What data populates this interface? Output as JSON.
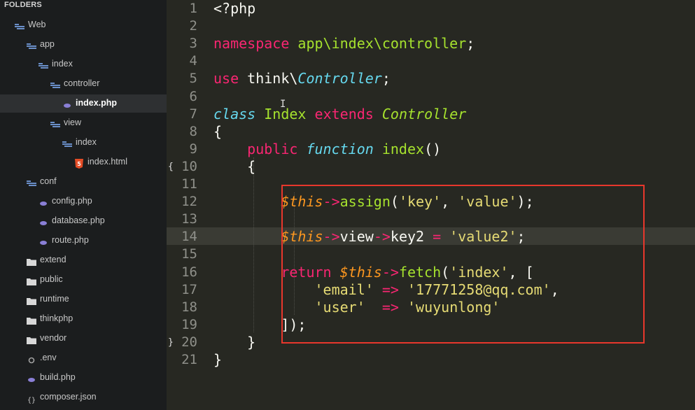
{
  "sidebar": {
    "title": "FOLDERS",
    "items": [
      {
        "label": "Web",
        "kind": "folder-open",
        "depth": 1
      },
      {
        "label": "app",
        "kind": "folder-open",
        "depth": 2
      },
      {
        "label": "index",
        "kind": "folder-open",
        "depth": 3
      },
      {
        "label": "controller",
        "kind": "folder-open",
        "depth": 4
      },
      {
        "label": "index.php",
        "kind": "file-php",
        "depth": 5,
        "selected": true
      },
      {
        "label": "view",
        "kind": "folder-open",
        "depth": 4
      },
      {
        "label": "index",
        "kind": "folder-open",
        "depth": 5
      },
      {
        "label": "index.html",
        "kind": "file-html",
        "depth": 6
      },
      {
        "label": "conf",
        "kind": "folder-open",
        "depth": 2
      },
      {
        "label": "config.php",
        "kind": "file-php",
        "depth": 3
      },
      {
        "label": "database.php",
        "kind": "file-php",
        "depth": 3
      },
      {
        "label": "route.php",
        "kind": "file-php",
        "depth": 3
      },
      {
        "label": "extend",
        "kind": "folder",
        "depth": 2
      },
      {
        "label": "public",
        "kind": "folder",
        "depth": 2
      },
      {
        "label": "runtime",
        "kind": "folder",
        "depth": 2
      },
      {
        "label": "thinkphp",
        "kind": "folder",
        "depth": 2
      },
      {
        "label": "vendor",
        "kind": "folder",
        "depth": 2
      },
      {
        "label": ".env",
        "kind": "file-env",
        "depth": 2
      },
      {
        "label": "build.php",
        "kind": "file-php",
        "depth": 2
      },
      {
        "label": "composer.json",
        "kind": "file-json",
        "depth": 2
      }
    ]
  },
  "editor": {
    "line_numbers": [
      "1",
      "2",
      "3",
      "4",
      "5",
      "6",
      "7",
      "8",
      "9",
      "10",
      "11",
      "12",
      "13",
      "14",
      "15",
      "16",
      "17",
      "18",
      "19",
      "20",
      "21"
    ],
    "fold_markers": [
      {
        "line": 10,
        "glyph": "{"
      },
      {
        "line": 20,
        "glyph": "}"
      }
    ],
    "highlighted_line": 14,
    "lines": [
      [
        {
          "t": "<?php",
          "c": ""
        }
      ],
      [],
      [
        {
          "t": "namespace",
          "c": "kw"
        },
        {
          "t": " app\\index\\controller",
          "c": "ns"
        },
        {
          "t": ";",
          "c": ""
        }
      ],
      [],
      [
        {
          "t": "use",
          "c": "kw"
        },
        {
          "t": " think\\",
          "c": ""
        },
        {
          "t": "Controller",
          "c": "cls"
        },
        {
          "t": ";",
          "c": ""
        }
      ],
      [],
      [
        {
          "t": "class",
          "c": "cls"
        },
        {
          "t": " ",
          "c": ""
        },
        {
          "t": "Index",
          "c": "ns"
        },
        {
          "t": " ",
          "c": ""
        },
        {
          "t": "extends",
          "c": "kw"
        },
        {
          "t": " ",
          "c": ""
        },
        {
          "t": "Controller",
          "c": "parent"
        }
      ],
      [
        {
          "t": "{",
          "c": ""
        }
      ],
      [
        {
          "t": "    ",
          "c": ""
        },
        {
          "t": "public",
          "c": "kw"
        },
        {
          "t": " ",
          "c": ""
        },
        {
          "t": "function",
          "c": "fnkw"
        },
        {
          "t": " ",
          "c": ""
        },
        {
          "t": "index",
          "c": "fn"
        },
        {
          "t": "()",
          "c": ""
        }
      ],
      [
        {
          "t": "    {",
          "c": ""
        }
      ],
      [],
      [
        {
          "t": "        ",
          "c": ""
        },
        {
          "t": "$this",
          "c": "var"
        },
        {
          "t": "->",
          "c": "kw"
        },
        {
          "t": "assign",
          "c": "fn"
        },
        {
          "t": "(",
          "c": ""
        },
        {
          "t": "'key'",
          "c": "str"
        },
        {
          "t": ", ",
          "c": ""
        },
        {
          "t": "'value'",
          "c": "str"
        },
        {
          "t": ");",
          "c": ""
        }
      ],
      [],
      [
        {
          "t": "        ",
          "c": ""
        },
        {
          "t": "$this",
          "c": "var"
        },
        {
          "t": "->",
          "c": "kw"
        },
        {
          "t": "view",
          "c": ""
        },
        {
          "t": "->",
          "c": "kw"
        },
        {
          "t": "key2 ",
          "c": ""
        },
        {
          "t": "=",
          "c": "kw"
        },
        {
          "t": " ",
          "c": ""
        },
        {
          "t": "'value2'",
          "c": "str"
        },
        {
          "t": ";",
          "c": ""
        }
      ],
      [],
      [
        {
          "t": "        ",
          "c": ""
        },
        {
          "t": "return",
          "c": "kw"
        },
        {
          "t": " ",
          "c": ""
        },
        {
          "t": "$this",
          "c": "var"
        },
        {
          "t": "->",
          "c": "kw"
        },
        {
          "t": "fetch",
          "c": "fn"
        },
        {
          "t": "(",
          "c": ""
        },
        {
          "t": "'index'",
          "c": "str"
        },
        {
          "t": ", [",
          "c": ""
        }
      ],
      [
        {
          "t": "            ",
          "c": ""
        },
        {
          "t": "'email'",
          "c": "str"
        },
        {
          "t": " ",
          "c": ""
        },
        {
          "t": "=>",
          "c": "kw"
        },
        {
          "t": " ",
          "c": ""
        },
        {
          "t": "'17771258@qq.com'",
          "c": "str"
        },
        {
          "t": ",",
          "c": ""
        }
      ],
      [
        {
          "t": "            ",
          "c": ""
        },
        {
          "t": "'user'",
          "c": "str"
        },
        {
          "t": "  ",
          "c": ""
        },
        {
          "t": "=>",
          "c": "kw"
        },
        {
          "t": " ",
          "c": ""
        },
        {
          "t": "'wuyunlong'",
          "c": "str"
        }
      ],
      [
        {
          "t": "        ]);",
          "c": ""
        }
      ],
      [
        {
          "t": "    }",
          "c": ""
        }
      ],
      [
        {
          "t": "}",
          "c": ""
        }
      ]
    ]
  },
  "colors": {
    "background": "#272822",
    "sidebar": "#1b1d1e",
    "annotation_box": "#e8372c",
    "keyword": "#f92672",
    "string": "#e6db74",
    "function": "#a6e22e",
    "type": "#66d9ef",
    "variable": "#fd971f"
  }
}
